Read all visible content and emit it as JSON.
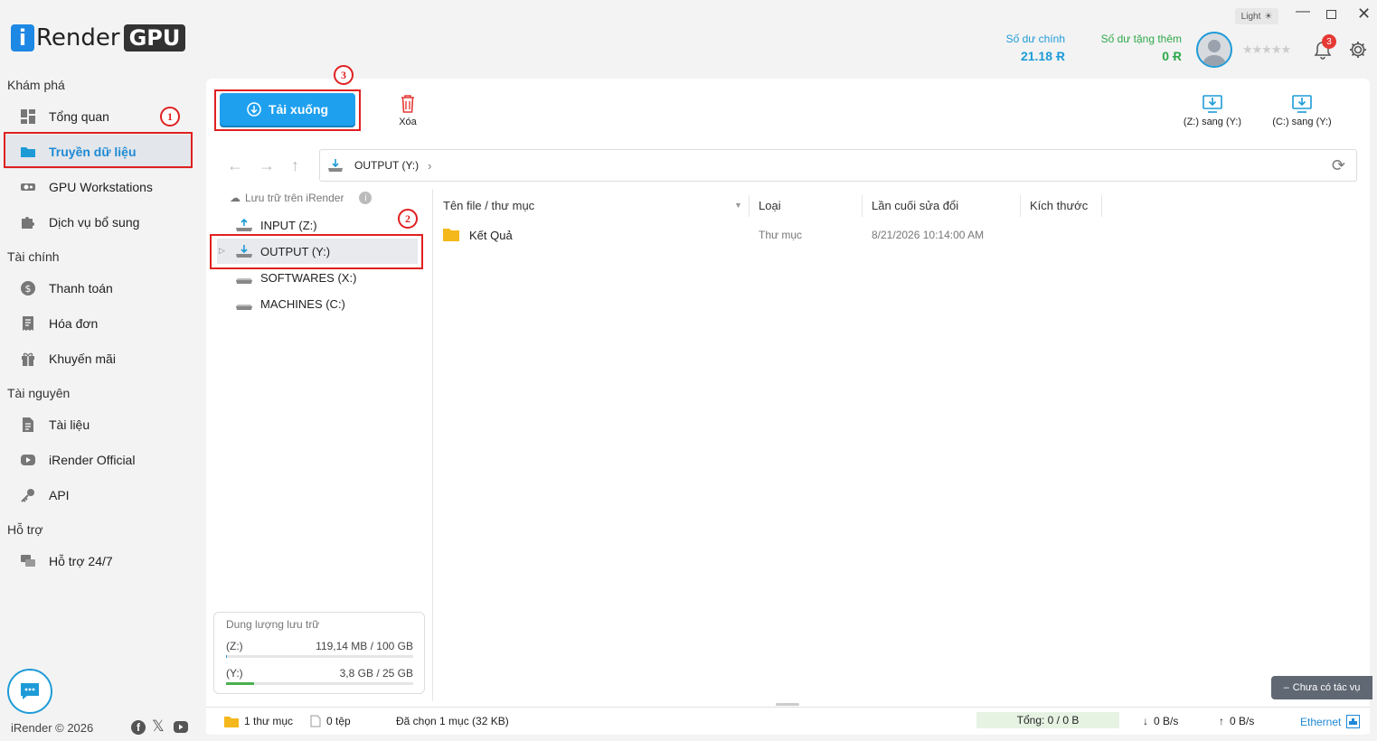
{
  "app": {
    "logo_i": "i",
    "logo_render": "Render",
    "logo_gpu": "GPU",
    "theme_label": "Light",
    "copyright": "iRender © 2026"
  },
  "header": {
    "main_balance_label": "Số dư chính",
    "main_balance_value": "21.18 Ɍ",
    "bonus_balance_label": "Số dư tặng thêm",
    "bonus_balance_value": "0 Ɍ",
    "rating": "★★★★★",
    "notification_count": "3"
  },
  "sidebar": {
    "sections": [
      "Khám phá",
      "Tài chính",
      "Tài nguyên",
      "Hỗ trợ"
    ],
    "items": [
      {
        "label": "Tổng quan",
        "icon": "dashboard-icon"
      },
      {
        "label": "Truyền dữ liệu",
        "icon": "folder-icon",
        "active": true
      },
      {
        "label": "GPU Workstations",
        "icon": "gpu-icon"
      },
      {
        "label": "Dịch vụ bổ sung",
        "icon": "puzzle-icon"
      },
      {
        "label": "Thanh toán",
        "icon": "dollar-icon"
      },
      {
        "label": "Hóa đơn",
        "icon": "invoice-icon"
      },
      {
        "label": "Khuyến mãi",
        "icon": "gift-icon"
      },
      {
        "label": "Tài liệu",
        "icon": "document-icon"
      },
      {
        "label": "iRender Official",
        "icon": "youtube-icon"
      },
      {
        "label": "API",
        "icon": "key-icon"
      },
      {
        "label": "Hỗ trợ 24/7",
        "icon": "chat-icon"
      }
    ]
  },
  "toolbar": {
    "download_label": "Tải xuống",
    "delete_label": "Xóa",
    "z_to_y_label": "(Z:) sang (Y:)",
    "c_to_y_label": "(C:) sang (Y:)"
  },
  "address": {
    "path": "OUTPUT (Y:)"
  },
  "tree": {
    "header": "Lưu trữ trên iRender",
    "drives": [
      "INPUT (Z:)",
      "OUTPUT (Y:)",
      "SOFTWARES (X:)",
      "MACHINES (C:)"
    ]
  },
  "table": {
    "columns": [
      "Tên file / thư mục",
      "Loại",
      "Lần cuối sửa đổi",
      "Kích thước"
    ],
    "rows": [
      {
        "name": "Kết Quả",
        "type": "Thư mục",
        "modified": "8/21/2026 10:14:00 AM",
        "size": ""
      }
    ]
  },
  "storage": {
    "title": "Dung lượng lưu trữ",
    "z_label": "(Z:)",
    "z_value": "119,14 MB  /  100 GB",
    "z_fill": 0.0012,
    "y_label": "(Y:)",
    "y_value": "3,8 GB  /  25 GB",
    "y_fill": 0.152
  },
  "status": {
    "folders": "1 thư mục",
    "files": "0 tệp",
    "selected": "Đã chọn 1 mục   (32 KB)",
    "total": "Tổng:   0  /  0 B",
    "down": "0 B/s",
    "up": "0 B/s",
    "network": "Ethernet"
  },
  "toast": "Chưa có tác vụ",
  "annotations": [
    "1",
    "2",
    "3"
  ],
  "colors": {
    "accent": "#1ea0ef",
    "annotation": "#e02020",
    "bonus": "#2ea84a"
  }
}
